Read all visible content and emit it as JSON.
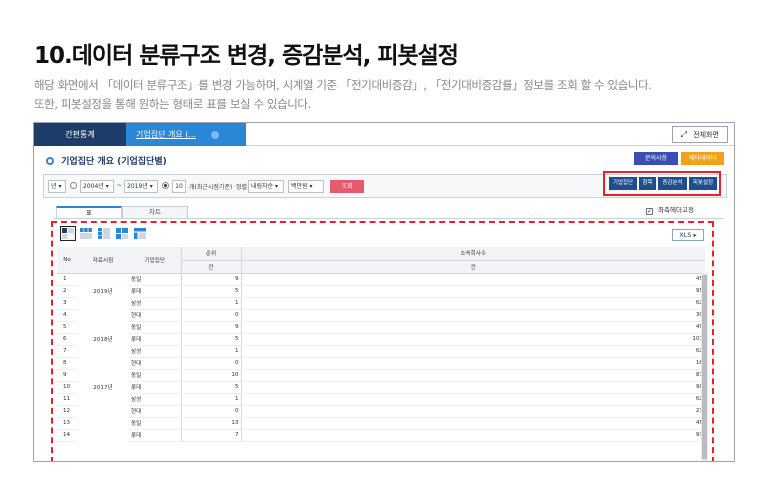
{
  "page": {
    "title": "10.데이터 분류구조 변경, 증감분석, 피봇설정",
    "desc_line1": "해당 화면에서 「데이터 분류구조」를 변경 가능하며, 시계열 기준 「전기대비증감」, 「전기대비증감률」정보를 조회 할 수 있습니다.",
    "desc_line2": "또한, 피봇설정을 통해 원하는 형태로 표를 보실 수 있습니다."
  },
  "tabs": {
    "main": "간편통계",
    "active": "기업집단 개요 (...",
    "fullscreen": "전체화면"
  },
  "section": {
    "title": "기업집단 개요 (기업집단별)",
    "inquiry": "문의사항",
    "metadata": "메타데이터"
  },
  "filter": {
    "unit_sel": "년",
    "start_year": "2004년",
    "range_sep": "~",
    "end_year": "2019년",
    "count": "10",
    "count_label": "개(최근시점기준)",
    "sort_label": "정렬",
    "sort_sel": "내림차순",
    "unit2_sel": "백만원",
    "query": "조회"
  },
  "functions": [
    "기업집단",
    "항목",
    "증감분석",
    "피봇설정"
  ],
  "view_tabs": {
    "table": "표",
    "chart": "차트"
  },
  "freeze_header": "좌측헤더고정",
  "xls": "XLS",
  "table": {
    "headers": {
      "no": "No",
      "period": "자료시점",
      "group": "기업집단",
      "rank": "순위",
      "rank_unit": "건",
      "affiliates": "소속회사수",
      "affiliates_unit": "건"
    },
    "rows": [
      {
        "no": "1",
        "year": "",
        "group": "동일",
        "rank": "9",
        "aff": "45"
      },
      {
        "no": "2",
        "year": "2019년",
        "group": "롯데",
        "rank": "5",
        "aff": "95"
      },
      {
        "no": "3",
        "year": "",
        "group": "삼성",
        "rank": "1",
        "aff": "62"
      },
      {
        "no": "4",
        "year": "",
        "group": "현대",
        "rank": "0",
        "aff": "30"
      },
      {
        "no": "5",
        "year": "",
        "group": "동일",
        "rank": "9",
        "aff": "49"
      },
      {
        "no": "6",
        "year": "2018년",
        "group": "롯데",
        "rank": "5",
        "aff": "107"
      },
      {
        "no": "7",
        "year": "",
        "group": "삼성",
        "rank": "1",
        "aff": "62"
      },
      {
        "no": "8",
        "year": "",
        "group": "현대",
        "rank": "0",
        "aff": "16"
      },
      {
        "no": "9",
        "year": "",
        "group": "동일",
        "rank": "10",
        "aff": "81"
      },
      {
        "no": "10",
        "year": "2017년",
        "group": "롯데",
        "rank": "5",
        "aff": "90"
      },
      {
        "no": "11",
        "year": "",
        "group": "삼성",
        "rank": "1",
        "aff": "62"
      },
      {
        "no": "12",
        "year": "",
        "group": "현대",
        "rank": "0",
        "aff": "21"
      },
      {
        "no": "13",
        "year": "",
        "group": "동일",
        "rank": "13",
        "aff": "45"
      },
      {
        "no": "14",
        "year": "",
        "group": "롯데",
        "rank": "7",
        "aff": "93"
      }
    ]
  },
  "colors": {
    "navy": "#1e3d6b",
    "tab_blue": "#2a86d6",
    "highlight_red": "#e8202a",
    "query_pink": "#e35b6c",
    "meta_orange": "#f0a21c"
  }
}
